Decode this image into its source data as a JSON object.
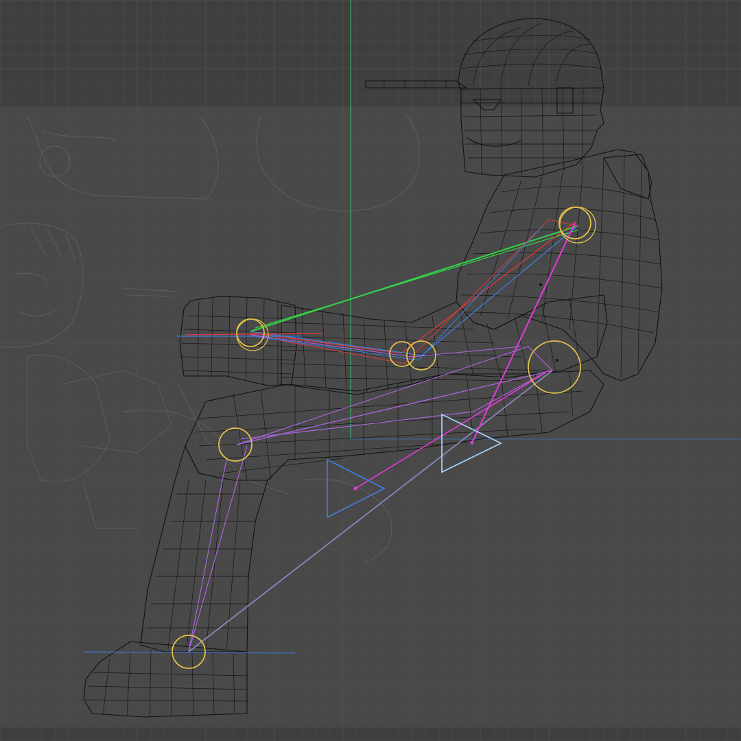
{
  "viewport": {
    "background": "#3f3f3f",
    "reference_image_fill": "#4a4a4a",
    "axis_y_color": "#3fa86a",
    "axis_x_color": "#3a6b9c"
  },
  "rig": {
    "bone_colors": {
      "ik_chain": "#35d14a",
      "arm_red": "#e23a3a",
      "arm_blue": "#3f7fe0",
      "leg": "#b067e6",
      "spine_pole": "#e63ae0"
    },
    "joint_color": "#e2c24a",
    "controller_color_active": "#a6cff5",
    "controller_color_inactive": "#3f7fe0"
  },
  "icons": {
    "joint": "circle-joint-icon",
    "controller": "triangle-controller-icon"
  }
}
